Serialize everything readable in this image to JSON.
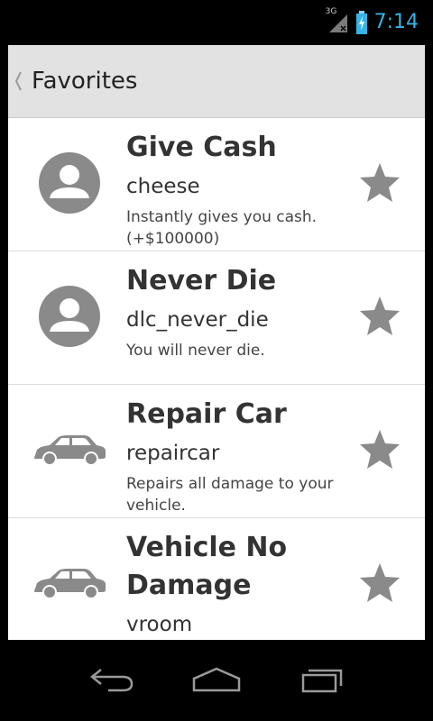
{
  "status_bar": {
    "network_label": "3G",
    "time": "7:14",
    "clock_color": "#33b5e5"
  },
  "action_bar": {
    "title": "Favorites"
  },
  "items": [
    {
      "title": "Give Cash",
      "code": "cheese",
      "description": "Instantly gives you cash. (+$100000)",
      "icon": "person-icon",
      "favorited": true
    },
    {
      "title": "Never Die",
      "code": "dlc_never_die",
      "description": "You will never die.",
      "icon": "person-icon",
      "favorited": true
    },
    {
      "title": "Repair Car",
      "code": "repaircar",
      "description": "Repairs all damage to your vehicle.",
      "icon": "car-icon",
      "favorited": true
    },
    {
      "title": "Vehicle No Damage",
      "code": "vroom",
      "description": "",
      "icon": "car-icon",
      "favorited": true
    }
  ],
  "nav_bar": {
    "buttons": [
      "back-icon",
      "home-icon",
      "recent-apps-icon"
    ]
  },
  "colors": {
    "action_bar_bg": "#e2e2e2",
    "icon_gray": "#8a8a8a",
    "star_gray": "#8a8a8a"
  }
}
